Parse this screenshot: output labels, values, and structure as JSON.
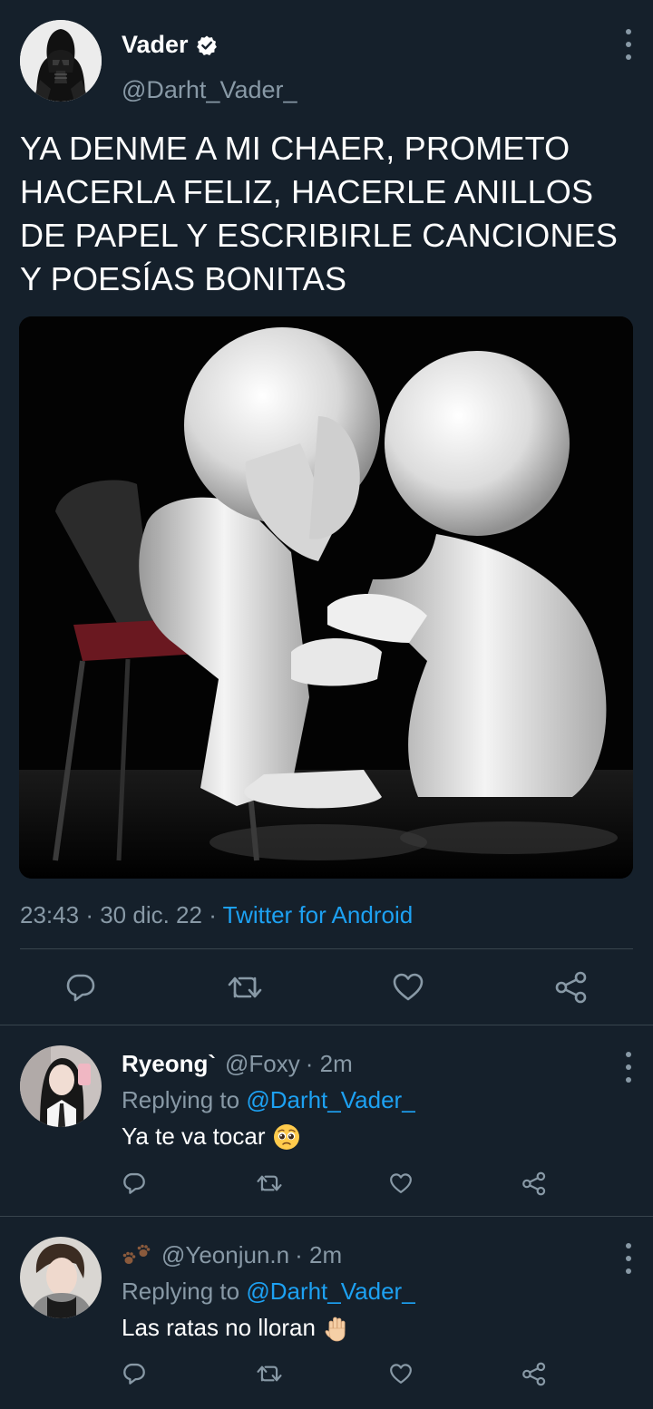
{
  "tweet": {
    "display_name": "Vader",
    "verified_icon": "verified-badge-icon",
    "handle": "@Darht_Vader_",
    "text_lines": [
      "YA DENME A MI CHAER, PROMETO",
      "HACERLA FELIZ, HACERLE ANILLOS",
      "DE PAPEL Y ESCRIBIRLE CANCIONES",
      "Y POESÍAS BONITAS"
    ],
    "time": "23:43",
    "date": "30 dic. 22",
    "separator": "·",
    "source": "Twitter for Android",
    "actions": [
      "reply-icon",
      "retweet-icon",
      "like-icon",
      "share-icon"
    ]
  },
  "replies": [
    {
      "name": "Ryeong`",
      "handle": "@Foxy",
      "time": "· 2m",
      "replying_prefix": "Replying to",
      "replying_mention": "@Darht_Vader_",
      "text": "Ya te va tocar",
      "emoji": "pleading-face-icon"
    },
    {
      "name_icon": "paw-prints-icon",
      "handle": "@Yeonjun.n",
      "time": "· 2m",
      "replying_prefix": "Replying to",
      "replying_mention": "@Darht_Vader_",
      "text": "Las ratas no lloran",
      "emoji": "raised-hand-icon"
    }
  ],
  "colors": {
    "background": "#15202b",
    "text": "#ffffff",
    "secondary": "#8899a6",
    "accent": "#1da1f2",
    "divider": "#38444d"
  }
}
